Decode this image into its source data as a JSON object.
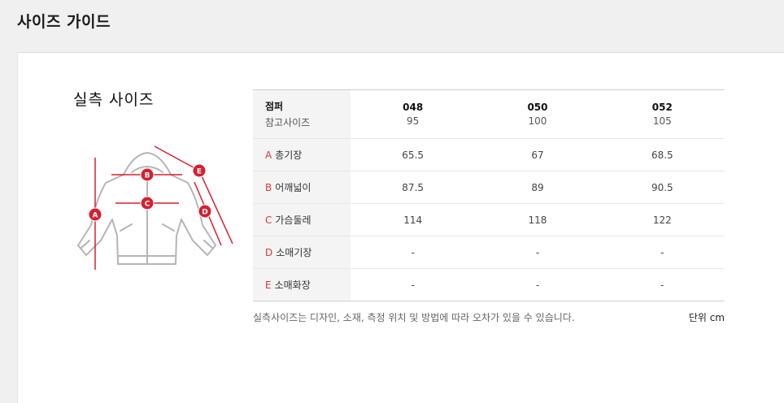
{
  "page": {
    "title": "사이즈 가이드"
  },
  "section": {
    "title": "실측 사이즈"
  },
  "diagram": {
    "markers": [
      "A",
      "B",
      "C",
      "D",
      "E"
    ],
    "marker_color": "#d6202f",
    "line_color": "#d6202f"
  },
  "table": {
    "header": {
      "label": "점퍼",
      "sublabel": "참고사이즈",
      "sizes": [
        {
          "code": "048",
          "ref": "95"
        },
        {
          "code": "050",
          "ref": "100"
        },
        {
          "code": "052",
          "ref": "105"
        }
      ]
    },
    "rows": [
      {
        "letter": "A",
        "name": "총기장",
        "values": [
          "65.5",
          "67",
          "68.5"
        ]
      },
      {
        "letter": "B",
        "name": "어깨넓이",
        "values": [
          "87.5",
          "89",
          "90.5"
        ]
      },
      {
        "letter": "C",
        "name": "가슴둘레",
        "values": [
          "114",
          "118",
          "122"
        ]
      },
      {
        "letter": "D",
        "name": "소매기장",
        "values": [
          "-",
          "-",
          "-"
        ]
      },
      {
        "letter": "E",
        "name": "소매화장",
        "values": [
          "-",
          "-",
          "-"
        ]
      }
    ]
  },
  "note": "실측사이즈는 디자인, 소재, 측정 위치 및 방법에 따라 오차가 있을 수 있습니다.",
  "unit": "단위 cm"
}
